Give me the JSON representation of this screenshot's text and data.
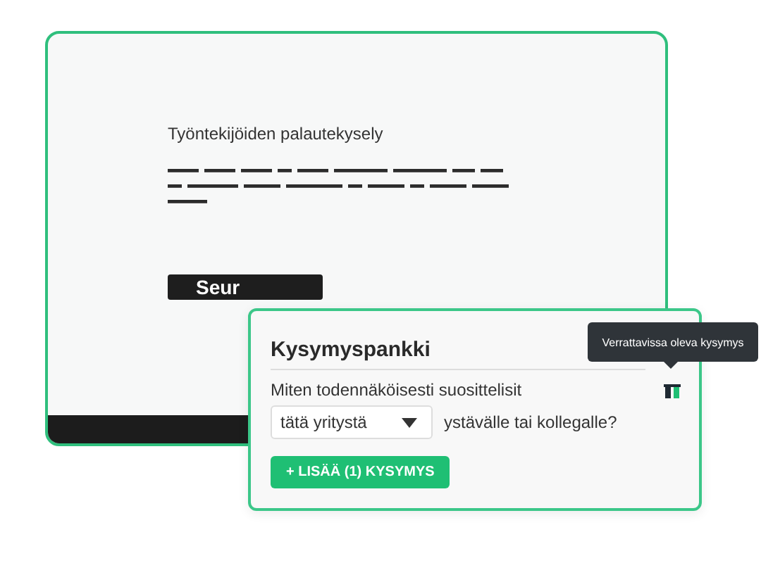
{
  "survey": {
    "title": "Työntekijöiden palautekysely",
    "next_button": "Seur"
  },
  "question_bank": {
    "title": "Kysymyspankki",
    "question_start": "Miten todennäköisesti suosittelisit",
    "dropdown": {
      "value": "tätä yritystä"
    },
    "question_end": "ystävälle tai kollegalle?",
    "add_button": "+ LISÄÄ (1) KYSYMYS",
    "tooltip": "Verrattavissa oleva kysymys"
  }
}
